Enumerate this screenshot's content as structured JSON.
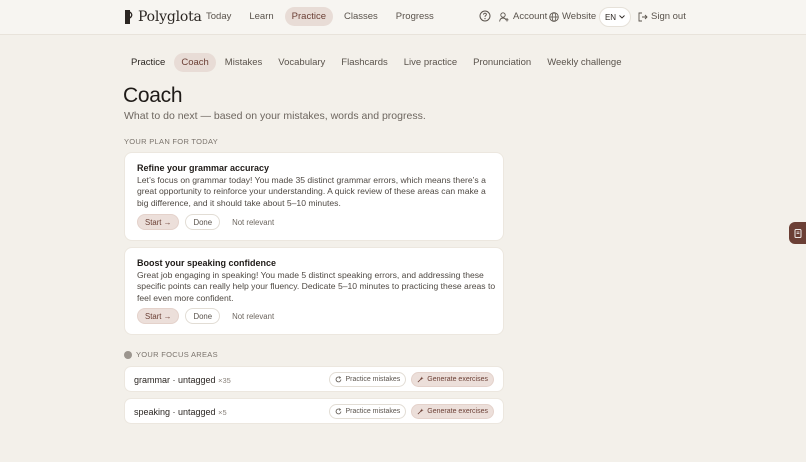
{
  "app": {
    "name": "Polyglota"
  },
  "nav": {
    "items": [
      {
        "label": "Today"
      },
      {
        "label": "Learn"
      },
      {
        "label": "Practice"
      },
      {
        "label": "Classes"
      },
      {
        "label": "Progress"
      }
    ]
  },
  "header": {
    "account_label": "Account",
    "website_label": "Website",
    "lang_label": "EN",
    "signout_label": "Sign out"
  },
  "subtabs": [
    {
      "label": "Practice"
    },
    {
      "label": "Coach"
    },
    {
      "label": "Mistakes"
    },
    {
      "label": "Vocabulary"
    },
    {
      "label": "Flashcards"
    },
    {
      "label": "Live practice"
    },
    {
      "label": "Pronunciation"
    },
    {
      "label": "Weekly challenge"
    }
  ],
  "page": {
    "title": "Coach",
    "subtitle": "What to do next — based on your mistakes, words and progress."
  },
  "plan": {
    "label": "YOUR PLAN FOR TODAY",
    "cards": [
      {
        "title": "Refine your grammar accuracy",
        "body": "Let’s focus on grammar today! You made 35 distinct grammar errors, which means there’s a great opportunity to reinforce your understanding. A quick review of these areas can make a big difference, and it should take about 5–10 minutes.",
        "start_label": "Start →",
        "done_label": "Done",
        "not_relevant_label": "Not relevant"
      },
      {
        "title": "Boost your speaking confidence",
        "body": "Great job engaging in speaking! You made 5 distinct speaking errors, and addressing these specific points can really help your fluency. Dedicate 5–10 minutes to practicing these areas to feel even more confident.",
        "start_label": "Start →",
        "done_label": "Done",
        "not_relevant_label": "Not relevant"
      }
    ]
  },
  "focus": {
    "label": "YOUR FOCUS AREAS",
    "rows": [
      {
        "name": "grammar · untagged",
        "count": "×35",
        "practice_label": "Practice mistakes",
        "generate_label": "Generate exercises"
      },
      {
        "name": "speaking · untagged",
        "count": "×5",
        "practice_label": "Practice mistakes",
        "generate_label": "Generate exercises"
      }
    ]
  },
  "colors": {
    "accent": "#6b3f35",
    "accent_soft": "#e8dcd6",
    "background": "#f3f0ea",
    "card": "#ffffff"
  }
}
